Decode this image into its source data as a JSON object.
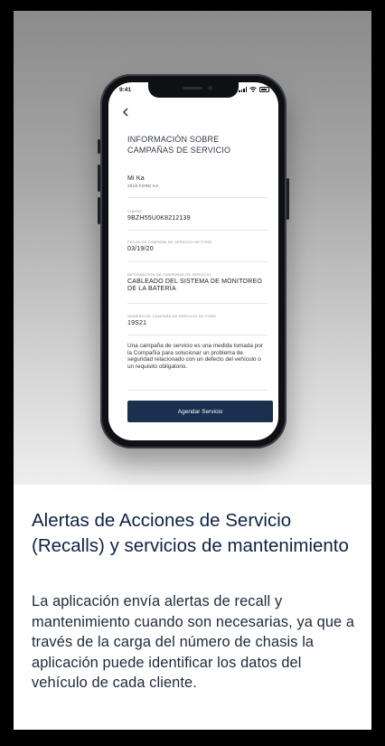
{
  "phone_screen": {
    "status_time": "9:41",
    "title": "INFORMACIÓN SOBRE CAMPAÑAS DE SERVICIO",
    "vehicle": {
      "name": "Mi Ka",
      "model": "2019 FORD KA"
    },
    "fields": [
      {
        "label": "Chasis",
        "value": "9BZH55U0K8212139"
      },
      {
        "label": "Fecha de campaña de servicio de Ford",
        "value": "03/19/20"
      },
      {
        "label": "Información de campañas de servicio",
        "value": "CABLEADO DEL SISTEMA DE MONITOREO DE LA BATERÍA"
      },
      {
        "label": "Número de campaña de servicio de Ford",
        "value": "19S21"
      }
    ],
    "description": "Una campaña de servicio es una medida tomada por la Compañía para solucionar un problema de seguridad relacionado con un defecto del vehículo o un requisito obligatorio.",
    "button_label": "Agendar Servicio",
    "icons": {
      "back": "chevron-left-icon",
      "signal": "signal-icon",
      "wifi": "wifi-icon",
      "battery": "battery-icon"
    }
  },
  "feature": {
    "heading": "Alertas de Acciones de Servicio (Recalls) y servicios de mantenimiento",
    "body": "La aplicación envía alertas de recall y mantenimiento cuando son necesarias, ya que a través de la carga del número de chasis la aplicación puede identificar los datos del vehículo de cada cliente."
  },
  "colors": {
    "brand_navy": "#1b2f4f",
    "heading": "#0e2344"
  }
}
